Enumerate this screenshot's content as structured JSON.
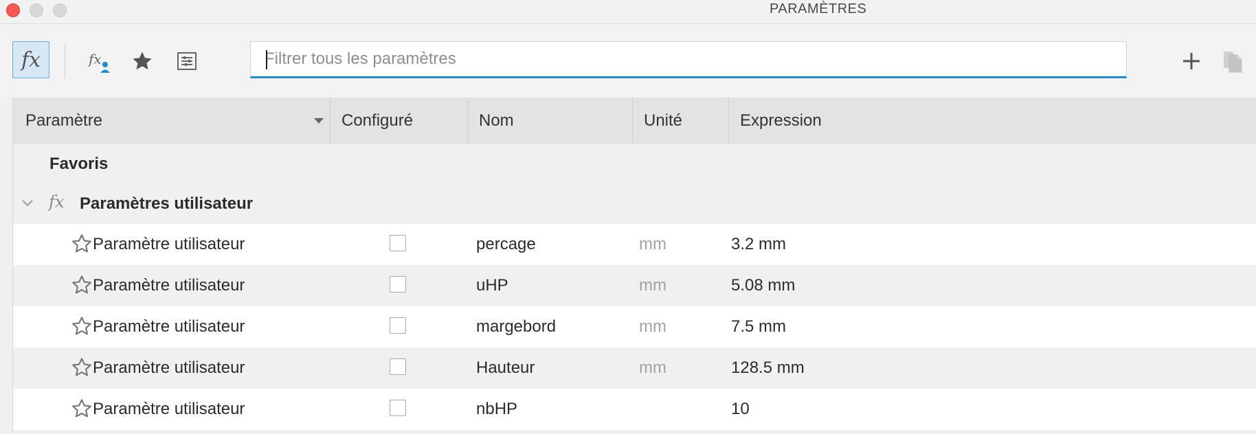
{
  "window": {
    "title": "PARAMÈTRES"
  },
  "toolbar": {
    "icons": [
      "fx-all-icon",
      "fx-user-icon",
      "favorites-star-icon",
      "settings-filter-icon",
      "add-icon",
      "copy-icon"
    ],
    "active_icon": "fx-all-icon",
    "fx_glyph": "fx",
    "search": {
      "placeholder": "Filtrer tous les paramètres",
      "value": ""
    }
  },
  "table": {
    "columns": [
      "Paramètre",
      "Configuré",
      "Nom",
      "Unité",
      "Expression"
    ],
    "groups": {
      "favorites": "Favoris",
      "user_params": "Paramètres utilisateur"
    },
    "rows": [
      {
        "parameter": "Paramètre utilisateur",
        "configured": false,
        "name": "percage",
        "unit": "mm",
        "expression": "3.2 mm"
      },
      {
        "parameter": "Paramètre utilisateur",
        "configured": false,
        "name": "uHP",
        "unit": "mm",
        "expression": "5.08 mm"
      },
      {
        "parameter": "Paramètre utilisateur",
        "configured": false,
        "name": "margebord",
        "unit": "mm",
        "expression": "7.5 mm"
      },
      {
        "parameter": "Paramètre utilisateur",
        "configured": false,
        "name": "Hauteur",
        "unit": "mm",
        "expression": "128.5 mm"
      },
      {
        "parameter": "Paramètre utilisateur",
        "configured": false,
        "name": "nbHP",
        "unit": "",
        "expression": "10"
      }
    ]
  },
  "colors": {
    "accent": "#1c8dd0",
    "active_bg": "#d6e8f4",
    "close": "#fc5753"
  }
}
